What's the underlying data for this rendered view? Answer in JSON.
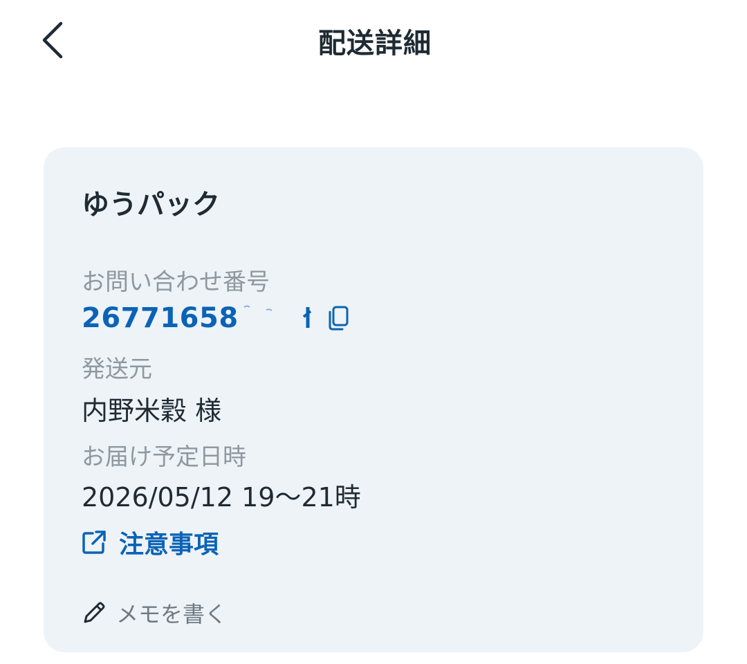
{
  "header": {
    "title": "配送詳細",
    "back_icon": "chevron-left-icon"
  },
  "card": {
    "carrier": "ゆうパック",
    "tracking": {
      "label": "お問い合わせ番号",
      "number": "26771658",
      "copy_icon": "copy-icon"
    },
    "sender": {
      "label": "発送元",
      "value": "内野米穀 様"
    },
    "delivery": {
      "label": "お届け予定日時",
      "value": "2026/05/12 19〜21時"
    },
    "notice_link": {
      "label": "注意事項",
      "icon": "external-link-icon"
    },
    "memo": {
      "label": "メモを書く",
      "icon": "pencil-icon"
    }
  },
  "colors": {
    "text": "#1f2b33",
    "muted": "#8e989f",
    "accent": "#0b63b6",
    "card_bg": "#eef3f7"
  }
}
